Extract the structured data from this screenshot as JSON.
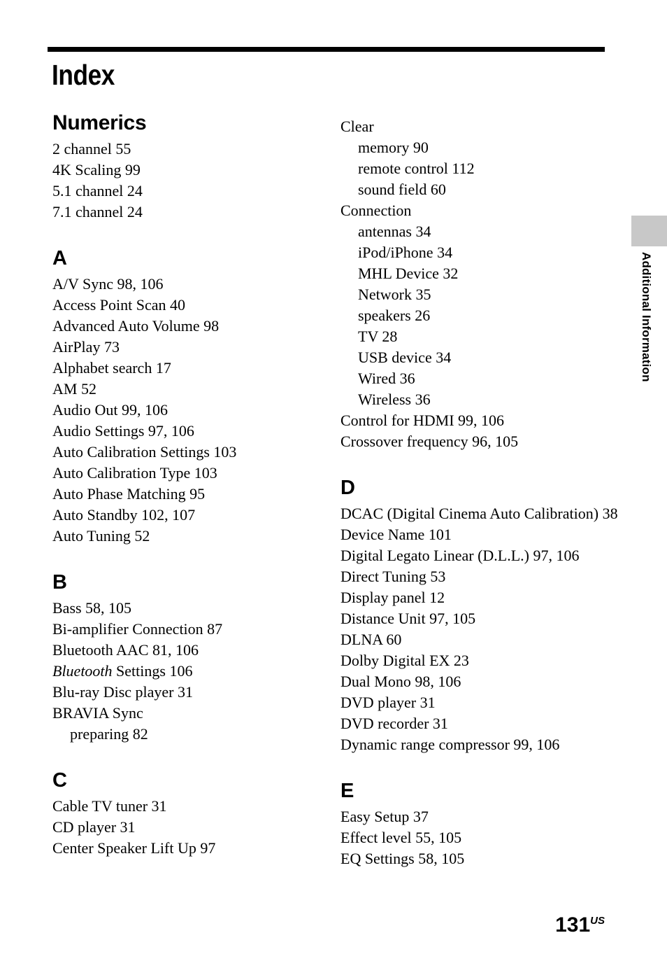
{
  "document": {
    "title": "Index",
    "page_number": "131",
    "page_number_suffix": "US",
    "side_tab_label": "Additional Information",
    "rule_color": "#000000",
    "side_tab_block_color": "#c8c8c8"
  },
  "columns": [
    {
      "id": "left",
      "sections": [
        {
          "heading": "Numerics",
          "entries": [
            {
              "text": "2 channel 55",
              "level": 0
            },
            {
              "text": "4K Scaling 99",
              "level": 0
            },
            {
              "text": "5.1 channel 24",
              "level": 0
            },
            {
              "text": "7.1 channel 24",
              "level": 0
            }
          ]
        },
        {
          "heading": "A",
          "entries": [
            {
              "text": "A/V Sync 98, 106",
              "level": 0
            },
            {
              "text": "Access Point Scan 40",
              "level": 0
            },
            {
              "text": "Advanced Auto Volume 98",
              "level": 0
            },
            {
              "text": "AirPlay 73",
              "level": 0
            },
            {
              "text": "Alphabet search 17",
              "level": 0
            },
            {
              "text": "AM 52",
              "level": 0
            },
            {
              "text": "Audio Out 99, 106",
              "level": 0
            },
            {
              "text": "Audio Settings 97, 106",
              "level": 0
            },
            {
              "text": "Auto Calibration Settings 103",
              "level": 0
            },
            {
              "text": "Auto Calibration Type 103",
              "level": 0
            },
            {
              "text": "Auto Phase Matching 95",
              "level": 0
            },
            {
              "text": "Auto Standby 102, 107",
              "level": 0
            },
            {
              "text": "Auto Tuning 52",
              "level": 0
            }
          ]
        },
        {
          "heading": "B",
          "entries": [
            {
              "text": "Bass 58, 105",
              "level": 0
            },
            {
              "text": "Bi-amplifier Connection 87",
              "level": 0
            },
            {
              "text": "Bluetooth AAC 81, 106",
              "level": 0
            },
            {
              "text": "Bluetooth Settings 106",
              "level": 0,
              "italic_prefix": "Bluetooth",
              "rest": " Settings 106"
            },
            {
              "text": "Blu-ray Disc player 31",
              "level": 0
            },
            {
              "text": "BRAVIA Sync",
              "level": 0
            },
            {
              "text": "preparing 82",
              "level": 1
            }
          ]
        },
        {
          "heading": "C",
          "entries": [
            {
              "text": "Cable TV tuner 31",
              "level": 0
            },
            {
              "text": "CD player 31",
              "level": 0
            },
            {
              "text": "Center Speaker Lift Up 97",
              "level": 0
            }
          ]
        }
      ]
    },
    {
      "id": "right",
      "sections": [
        {
          "heading": "",
          "entries": [
            {
              "text": "Clear",
              "level": 0
            },
            {
              "text": "memory 90",
              "level": 1
            },
            {
              "text": "remote control 112",
              "level": 1
            },
            {
              "text": "sound field 60",
              "level": 1
            },
            {
              "text": "Connection",
              "level": 0
            },
            {
              "text": "antennas 34",
              "level": 1
            },
            {
              "text": "iPod/iPhone 34",
              "level": 1
            },
            {
              "text": "MHL Device 32",
              "level": 1
            },
            {
              "text": "Network 35",
              "level": 1
            },
            {
              "text": "speakers 26",
              "level": 1
            },
            {
              "text": "TV 28",
              "level": 1
            },
            {
              "text": "USB device 34",
              "level": 1
            },
            {
              "text": "Wired 36",
              "level": 1
            },
            {
              "text": "Wireless 36",
              "level": 1
            },
            {
              "text": "Control for HDMI 99, 106",
              "level": 0
            },
            {
              "text": "Crossover frequency 96, 105",
              "level": 0
            }
          ]
        },
        {
          "heading": "D",
          "entries": [
            {
              "text": "DCAC (Digital Cinema Auto Calibration) 38",
              "level": 0,
              "wrap": true
            },
            {
              "text": "Device Name 101",
              "level": 0
            },
            {
              "text": "Digital Legato Linear (D.L.L.) 97, 106",
              "level": 0
            },
            {
              "text": "Direct Tuning 53",
              "level": 0
            },
            {
              "text": "Display panel 12",
              "level": 0
            },
            {
              "text": "Distance Unit 97, 105",
              "level": 0
            },
            {
              "text": "DLNA 60",
              "level": 0
            },
            {
              "text": "Dolby Digital EX 23",
              "level": 0
            },
            {
              "text": "Dual Mono 98, 106",
              "level": 0
            },
            {
              "text": "DVD player 31",
              "level": 0
            },
            {
              "text": "DVD recorder 31",
              "level": 0
            },
            {
              "text": "Dynamic range compressor 99, 106",
              "level": 0
            }
          ]
        },
        {
          "heading": "E",
          "entries": [
            {
              "text": "Easy Setup 37",
              "level": 0
            },
            {
              "text": "Effect level 55, 105",
              "level": 0
            },
            {
              "text": "EQ Settings 58, 105",
              "level": 0
            }
          ]
        }
      ]
    }
  ]
}
